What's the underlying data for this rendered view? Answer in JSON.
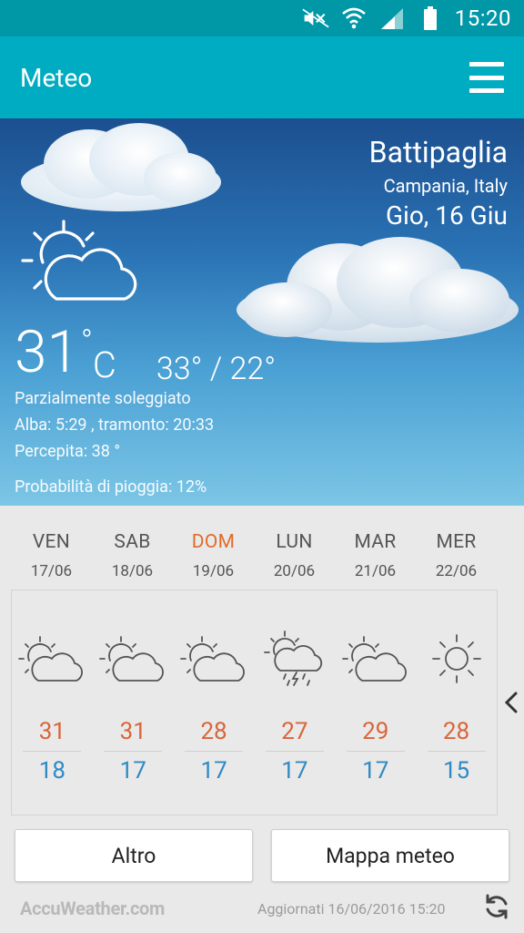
{
  "status_bar": {
    "time": "15:20",
    "icons": [
      "mute-icon",
      "wifi-icon",
      "signal-icon",
      "battery-icon"
    ]
  },
  "app_bar": {
    "title": "Meteo",
    "menu_icon": "hamburger-menu-icon"
  },
  "current": {
    "city": "Battipaglia",
    "region": "Campania, Italy",
    "date": "Gio, 16 Giu",
    "temp": "31",
    "temp_deg": "°",
    "unit": "C",
    "range": "33° / 22°",
    "condition": "Parzialmente soleggiato",
    "sun": "Alba: 5:29 , tramonto: 20:33",
    "feels": "Percepita: 38 °",
    "rain": "Probabilità di pioggia: 12%",
    "icon": "partly-sunny-icon"
  },
  "forecast": [
    {
      "day": "VEN",
      "date": "17/06",
      "icon": "partly-sunny-icon",
      "hi": "31",
      "lo": "18"
    },
    {
      "day": "SAB",
      "date": "18/06",
      "icon": "partly-sunny-icon",
      "hi": "31",
      "lo": "17"
    },
    {
      "day": "DOM",
      "date": "19/06",
      "icon": "partly-sunny-icon",
      "hi": "28",
      "lo": "17"
    },
    {
      "day": "LUN",
      "date": "20/06",
      "icon": "thunderstorm-sun-icon",
      "hi": "27",
      "lo": "17"
    },
    {
      "day": "MAR",
      "date": "21/06",
      "icon": "partly-sunny-icon",
      "hi": "29",
      "lo": "17"
    },
    {
      "day": "MER",
      "date": "22/06",
      "icon": "sunny-icon",
      "hi": "28",
      "lo": "15"
    }
  ],
  "buttons": {
    "more": "Altro",
    "map": "Mappa meteo"
  },
  "footer": {
    "provider": "AccuWeather.com",
    "updated": "Aggiornati 16/06/2016 15:20"
  },
  "colors": {
    "status_bar": "#0097a7",
    "app_bar": "#00acc1",
    "high_temp": "#d9653a",
    "low_temp": "#2f8ac4",
    "sunday": "#e26b2b"
  }
}
